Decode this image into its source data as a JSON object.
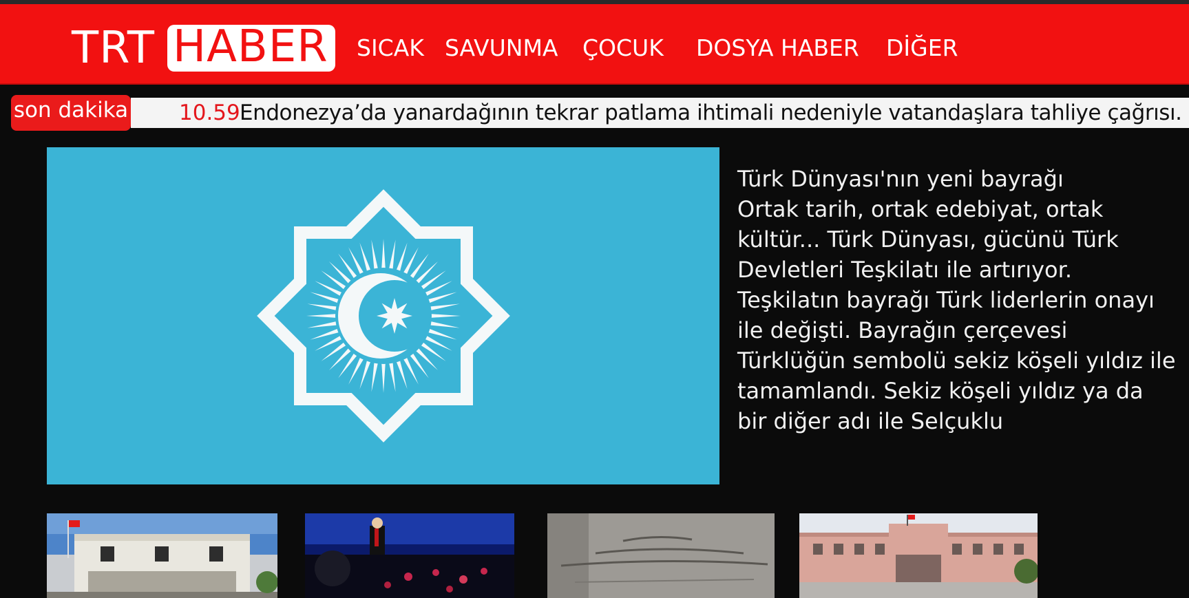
{
  "header": {
    "logo_part1": "TRT",
    "logo_part2": "HABER",
    "nav": [
      "SICAK",
      "SAVUNMA",
      "ÇOCUK",
      "DOSYA HABER",
      "DİĞER"
    ]
  },
  "ticker": {
    "badge": "son dakika",
    "time": "10.59",
    "text": "Endonezya’da yanardağının tekrar patlama ihtimali  nedeniyle vatandaşlara tahliye çağrısı."
  },
  "story": {
    "title": "Türk Dünyası'nın yeni bayrağı",
    "body": "Ortak tarih, ortak edebiyat, ortak kültür... Türk Dünyası, gücünü Türk Devletleri Teşkilatı ile artırıyor. Teşkilatın bayrağı Türk liderlerin onayı ile değişti. Bayrağın çerçevesi Türklüğün sembolü sekiz köşeli yıldız ile tamamlandı. Sekiz köşeli yıldız ya da bir diğer adı ile Selçuklu"
  },
  "colors": {
    "brand_red": "#f21111",
    "flag_blue": "#3bb4d6",
    "background": "#0b0b0b"
  }
}
